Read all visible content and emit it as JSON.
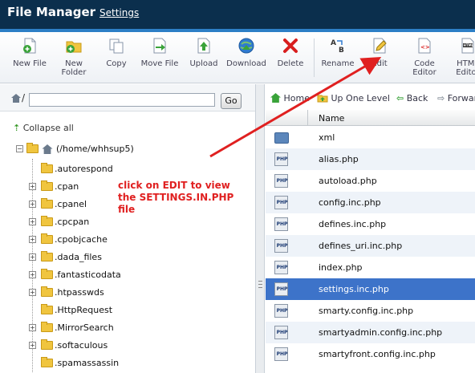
{
  "header": {
    "title": "File Manager",
    "settings_link": "Settings"
  },
  "toolbar": [
    {
      "id": "new-file",
      "label": "New File",
      "icon": "new-file-icon"
    },
    {
      "id": "new-folder",
      "label": "New Folder",
      "icon": "new-folder-icon"
    },
    {
      "id": "copy",
      "label": "Copy",
      "icon": "copy-icon"
    },
    {
      "id": "move-file",
      "label": "Move File",
      "icon": "move-file-icon"
    },
    {
      "id": "upload",
      "label": "Upload",
      "icon": "upload-icon"
    },
    {
      "id": "download",
      "label": "Download",
      "icon": "download-icon"
    },
    {
      "id": "delete",
      "label": "Delete",
      "icon": "delete-icon"
    },
    {
      "id": "rename",
      "label": "Rename",
      "icon": "rename-icon"
    },
    {
      "id": "edit",
      "label": "Edit",
      "icon": "edit-pencil-icon"
    },
    {
      "id": "code-editor",
      "label": "Code Editor",
      "icon": "code-editor-icon"
    },
    {
      "id": "html-editor",
      "label": "HTML Editor",
      "icon": "html-editor-icon"
    }
  ],
  "address": {
    "prefix": "/",
    "value": "",
    "go_label": "Go"
  },
  "tree": {
    "collapse_label": "Collapse all",
    "root_label": "(/home/whhsup5)",
    "items": [
      {
        "label": ".autorespond",
        "expandable": false
      },
      {
        "label": ".cpan",
        "expandable": true
      },
      {
        "label": ".cpanel",
        "expandable": true
      },
      {
        "label": ".cpcpan",
        "expandable": true
      },
      {
        "label": ".cpobjcache",
        "expandable": true
      },
      {
        "label": ".dada_files",
        "expandable": true
      },
      {
        "label": ".fantasticodata",
        "expandable": true
      },
      {
        "label": ".htpasswds",
        "expandable": true
      },
      {
        "label": ".HttpRequest",
        "expandable": false
      },
      {
        "label": ".MirrorSearch",
        "expandable": true
      },
      {
        "label": ".softaculous",
        "expandable": true
      },
      {
        "label": ".spamassassin",
        "expandable": false
      }
    ]
  },
  "nav": {
    "home": "Home",
    "up": "Up One Level",
    "back": "Back",
    "forward": "Forward"
  },
  "list": {
    "column_name": "Name",
    "selected_index": 8,
    "rows": [
      {
        "name": "xml",
        "type": "folder"
      },
      {
        "name": "alias.php",
        "type": "php"
      },
      {
        "name": "autoload.php",
        "type": "php"
      },
      {
        "name": "config.inc.php",
        "type": "php"
      },
      {
        "name": "defines.inc.php",
        "type": "php"
      },
      {
        "name": "defines_uri.inc.php",
        "type": "php"
      },
      {
        "name": "index.php",
        "type": "php"
      },
      {
        "name": "settings.inc.php",
        "type": "php"
      },
      {
        "name": "smarty.config.inc.php",
        "type": "php"
      },
      {
        "name": "smartyadmin.config.inc.php",
        "type": "php"
      },
      {
        "name": "smartyfront.config.inc.php",
        "type": "php"
      }
    ]
  },
  "annotation": {
    "text": "click on EDIT to view the SETTINGS.IN.PHP file",
    "color": "#e02020"
  },
  "colors": {
    "header_bg": "#0b2f4d",
    "selection": "#3d73c9",
    "accent_line": "#2d7fc6"
  }
}
